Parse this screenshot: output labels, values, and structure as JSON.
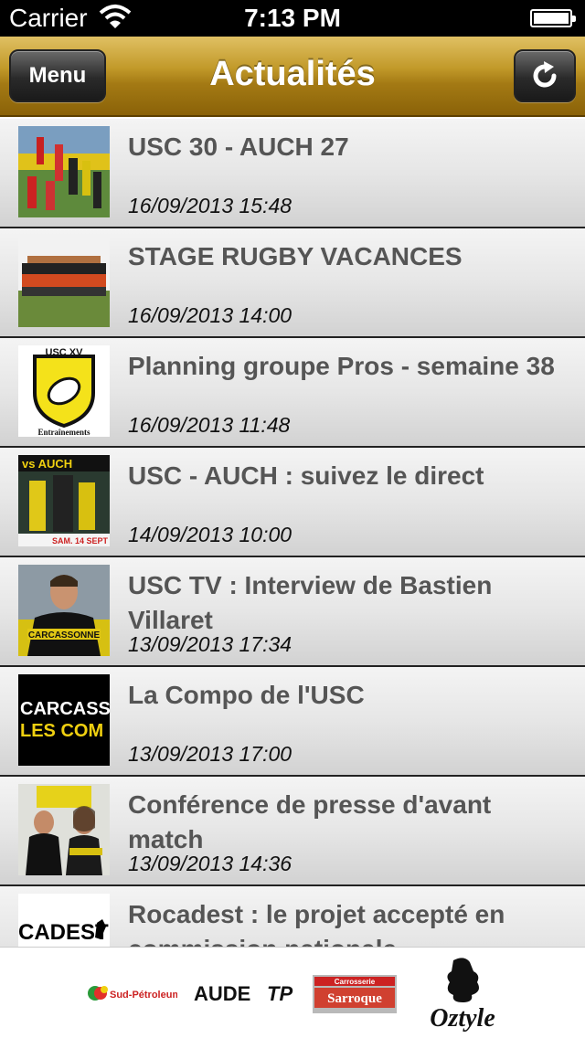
{
  "status_bar": {
    "carrier": "Carrier",
    "time": "7:13 PM"
  },
  "nav": {
    "title": "Actualités",
    "menu_label": "Menu",
    "refresh_icon": "refresh-icon"
  },
  "news": [
    {
      "title": "USC 30 - AUCH 27",
      "date": "16/09/2013 15:48"
    },
    {
      "title": "STAGE RUGBY VACANCES",
      "date": "16/09/2013 14:00"
    },
    {
      "title": "Planning groupe Pros - semaine 38",
      "date": "16/09/2013 11:48"
    },
    {
      "title": "USC - AUCH : suivez le direct",
      "date": "14/09/2013 10:00"
    },
    {
      "title": "USC TV : Interview de Bastien Villaret",
      "date": "13/09/2013 17:34"
    },
    {
      "title": "La Compo de l'USC",
      "date": "13/09/2013 17:00"
    },
    {
      "title": "Conférence de presse d'avant match",
      "date": "13/09/2013 14:36"
    },
    {
      "title": "Rocadest : le projet accepté en commission nationale",
      "date": ""
    }
  ],
  "thumbnails": {
    "thumb3": {
      "top": "USC XV",
      "bottom": "Entraînements"
    },
    "thumb4": {
      "top": "vs AUCH",
      "bottom": "SAM. 14 SEPT"
    },
    "thumb5": {
      "text": "CARCASSONNE"
    },
    "thumb6": {
      "line1": "CARCASS",
      "line2": "LES COM"
    },
    "thumb8": {
      "text": "CADEST"
    }
  },
  "sponsors": [
    {
      "name": "Sud-Pétroleum"
    },
    {
      "name": "AUDE",
      "suffix": "TP"
    },
    {
      "name": "Carrosserie",
      "sub": "Sarroque"
    },
    {
      "name": "Oztyle"
    }
  ]
}
